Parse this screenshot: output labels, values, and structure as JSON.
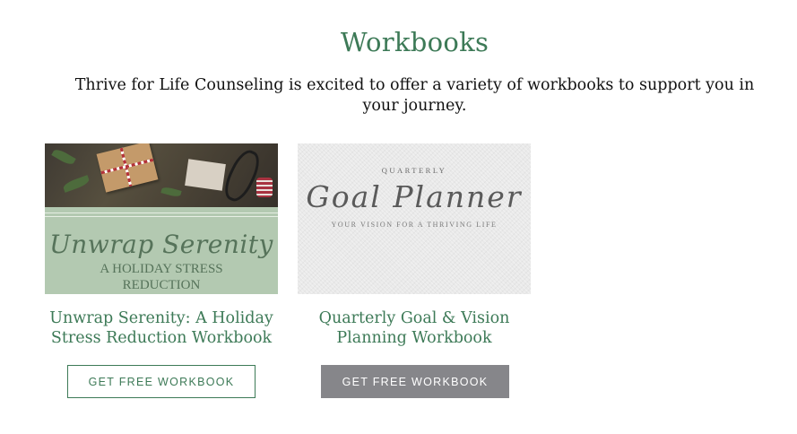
{
  "header": {
    "title": "Workbooks",
    "intro": "Thrive for Life Counseling is excited to offer a variety of workbooks to support you in your journey."
  },
  "workbooks": [
    {
      "thumb": {
        "script": "Unwrap Serenity",
        "caps_line1": "A HOLIDAY STRESS",
        "caps_line2": "REDUCTION"
      },
      "title": "Unwrap Serenity: A Holiday Stress Reduction Workbook",
      "button_label": "GET FREE WORKBOOK",
      "button_style": "outline"
    },
    {
      "thumb": {
        "top": "QUARTERLY",
        "script": "Goal Planner",
        "sub": "YOUR VISION FOR A THRIVING LIFE"
      },
      "title": "Quarterly Goal & Vision Planning Workbook",
      "button_label": "GET FREE WORKBOOK",
      "button_style": "filled"
    }
  ],
  "colors": {
    "accent_green": "#3d7a57",
    "button_gray": "#86868a",
    "panel_green": "#b3c9b1"
  }
}
